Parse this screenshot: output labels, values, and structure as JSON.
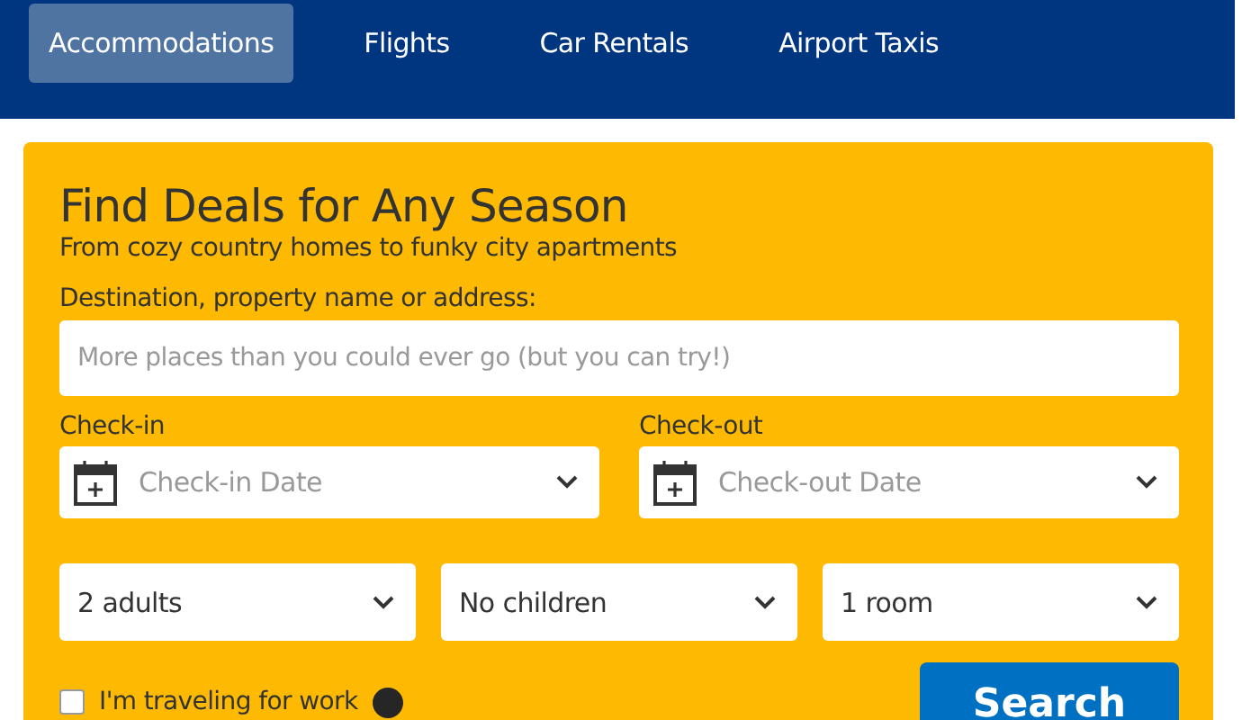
{
  "tabs": [
    {
      "label": "Accommodations",
      "selected": true
    },
    {
      "label": "Flights",
      "selected": false
    },
    {
      "label": "Car Rentals",
      "selected": false
    },
    {
      "label": "Airport Taxis",
      "selected": false
    }
  ],
  "search_panel": {
    "title": "Find Deals for Any Season",
    "subtitle": "From cozy country homes to funky city apartments",
    "destination": {
      "label": "Destination, property name or address:",
      "placeholder": "More places than you could ever go (but you can try!)"
    },
    "dates": [
      {
        "label": "Check-in",
        "placeholder": "Check-in Date"
      },
      {
        "label": "Check-out",
        "placeholder": "Check-out Date"
      }
    ],
    "selects": [
      {
        "value": "2 adults"
      },
      {
        "value": "No children"
      },
      {
        "value": "1 room"
      }
    ],
    "work_travel": {
      "label": "I'm traveling for work",
      "checked": false
    },
    "search_button": "Search"
  }
}
